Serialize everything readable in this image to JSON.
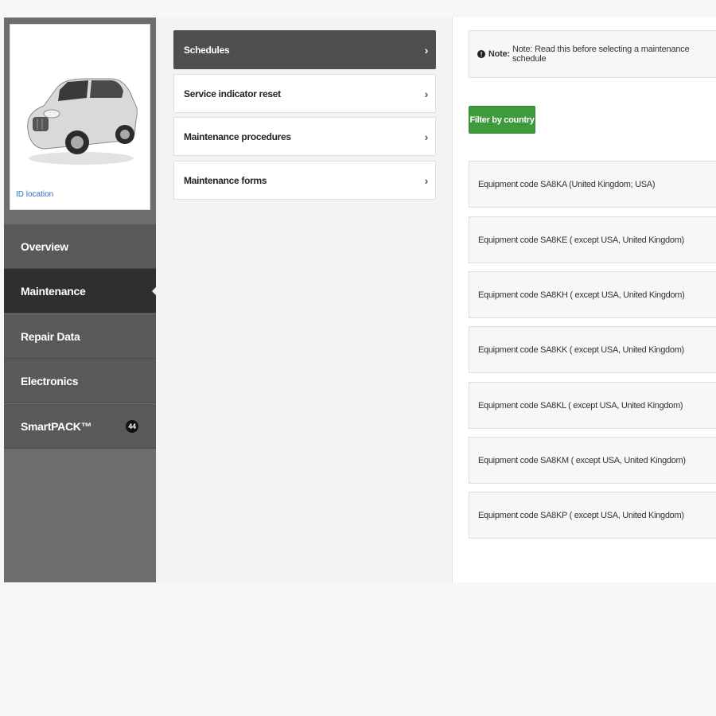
{
  "vehicle": {
    "id_location_label": "ID location"
  },
  "nav": {
    "items": [
      {
        "label": "Overview"
      },
      {
        "label": "Maintenance"
      },
      {
        "label": "Repair Data"
      },
      {
        "label": "Electronics"
      },
      {
        "label": "SmartPACK™",
        "badge": "44"
      }
    ],
    "active": "Maintenance"
  },
  "menu": {
    "items": [
      {
        "label": "Schedules"
      },
      {
        "label": "Service indicator reset"
      },
      {
        "label": "Maintenance procedures"
      },
      {
        "label": "Maintenance forms"
      }
    ],
    "active": "Schedules",
    "chevron": "›"
  },
  "note": {
    "icon": "!",
    "bold": "Note:",
    "text": "Note: Read this before selecting a maintenance schedule"
  },
  "filter_button": "Filter by country",
  "equipment": [
    "Equipment code SA8KA (United Kingdom; USA)",
    "Equipment code SA8KE ( except USA, United Kingdom)",
    "Equipment code SA8KH ( except USA, United Kingdom)",
    "Equipment code SA8KK ( except USA, United Kingdom)",
    "Equipment code SA8KL ( except USA, United Kingdom)",
    "Equipment code SA8KM ( except USA, United Kingdom)",
    "Equipment code SA8KP ( except USA, United Kingdom)"
  ],
  "colors": {
    "accent_green": "#3d9a3d",
    "active_nav": "#2f2f2f",
    "active_menu": "#4f4f4f"
  }
}
